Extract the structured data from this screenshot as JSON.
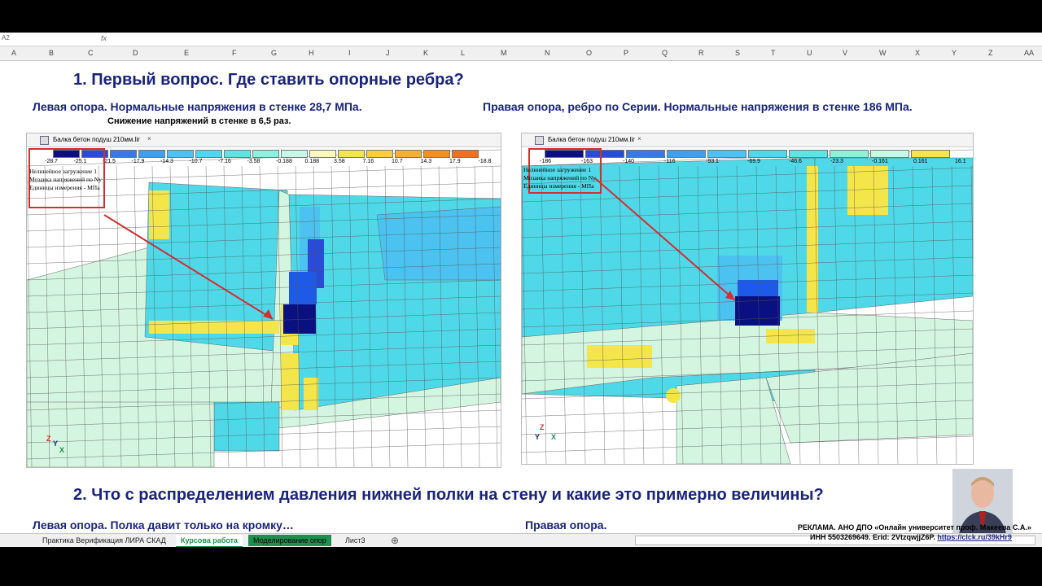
{
  "formula_bar": {
    "cell": "A2",
    "fx": "fx"
  },
  "columns": [
    "A",
    "B",
    "C",
    "D",
    "E",
    "F",
    "G",
    "H",
    "I",
    "J",
    "K",
    "L",
    "M",
    "N",
    "O",
    "P",
    "Q",
    "R",
    "S",
    "T",
    "U",
    "V",
    "W",
    "X",
    "Y",
    "Z",
    "AA"
  ],
  "heading1": "1.  Первый вопрос. Где ставить опорные ребра?",
  "left_caption": "Левая опора. Нормальные напряжения в стенке 28,7 МПа.",
  "right_caption": "Правая опора, ребро по Серии. Нормальные напряжения в стенке 186 МПа.",
  "reduction_note": "Снижение напряжений в стенке в 6,5 раз.",
  "panel_left": {
    "tab_title": "Балка бетон подуш 210мм.lir",
    "close": "×",
    "scale_labels": [
      "-28.7",
      "-25.1",
      "-21.5",
      "-17.9",
      "-14.3",
      "-10.7",
      "-7.16",
      "-3.58",
      "-0.188",
      "0.188",
      "3.58",
      "7.16",
      "10.7",
      "14.3",
      "17.9",
      "-18.8"
    ],
    "legend_lines": [
      "Нелинейное загружение 1",
      "Мозаика напряжений по Ny",
      "Единицы измерения - МПа"
    ],
    "axis_z": "Z",
    "axis_y": "Y",
    "axis_x": "X"
  },
  "panel_right": {
    "tab_title": "Балка бетон подуш 210мм.lir",
    "close": "×",
    "scale_labels": [
      "-186",
      "-163",
      "-140",
      "-116",
      "-93.1",
      "-69.9",
      "-46.6",
      "-23.3",
      "-0.161",
      "0.161",
      "16.1"
    ],
    "legend_lines": [
      "Нелинейное загружение 1",
      "Мозаика напряжений по Ny",
      "Единицы измерения - МПа"
    ],
    "axis_z": "Z",
    "axis_y": "Y",
    "axis_x": "X"
  },
  "heading2": "2. Что с распределением давления нижней полки на стену и какие это примерно величины?",
  "left_caption2": "Левая опора. Полка давит только на кромку…",
  "right_caption2": "Правая опора.",
  "sheet_tabs": [
    "Практика Верификация ЛИРА СКАД",
    "Курсова работа",
    "Моделирование опор",
    "Лист3"
  ],
  "add_sheet": "⊕",
  "ad_line1": "РЕКЛАМА. АНО ДПО «Онлайн университет проф. Макеева С.А.»",
  "ad_line2": "ИНН 5503269649. Erid: 2VtzqwjjZ6P.",
  "ad_link": "https://clck.ru/39kHr9",
  "colors": {
    "heading": "#1a237e",
    "legend_border": "#d32f2f",
    "arrow": "#d32f2f",
    "mesh_cyan": "#4fd8e8",
    "mesh_light": "#d4f5e0",
    "mesh_yellow": "#f4e64a",
    "mesh_blue": "#1e5ae8",
    "mesh_navy": "#0a1080",
    "active_tab": "#1e8f4e"
  },
  "scale_colors_left": [
    "#0a1080",
    "#2a4ad8",
    "#3a78e8",
    "#40a0f0",
    "#4cc2f0",
    "#4fd8e8",
    "#5fe4e4",
    "#8ff0e0",
    "#c8f8e8",
    "#f8f8c0",
    "#f4e64a",
    "#f4d040",
    "#f4b030",
    "#f49020",
    "#f07020"
  ],
  "scale_colors_right": [
    "#0a1080",
    "#2a4ad8",
    "#3a78e8",
    "#40a0f0",
    "#4cc2f0",
    "#4fd8e8",
    "#5fe4e4",
    "#8ff0e0",
    "#c8f8e8",
    "#f4e64a"
  ]
}
